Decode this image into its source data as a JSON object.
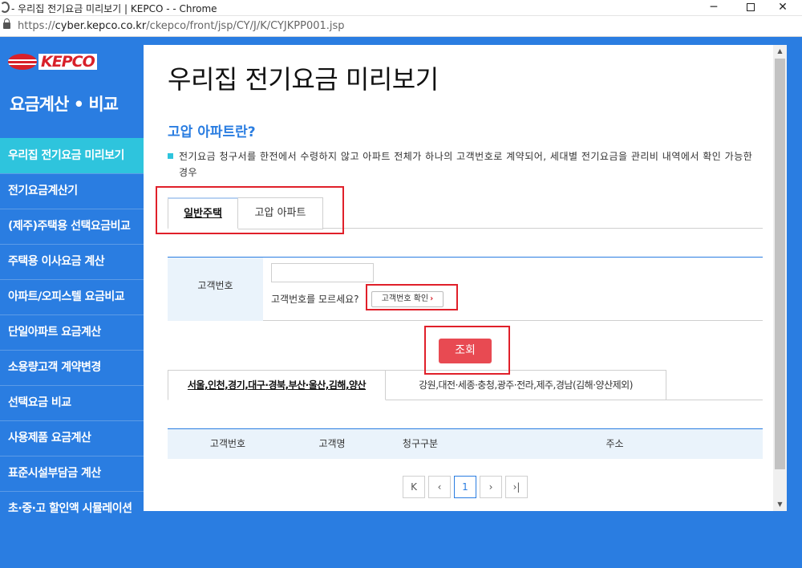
{
  "window": {
    "title": "- 우리집 전기요금 미리보기 | KEPCO - - Chrome",
    "minimize": "─",
    "close": "✕"
  },
  "address_bar": {
    "url_scheme": "https://",
    "url_host": "cyber.kepco.co.kr",
    "url_path": "/ckepco/front/jsp/CY/J/K/CYJKPP001.jsp"
  },
  "sidebar": {
    "logo": "KEPCO",
    "title": "요금계산 • 비교",
    "items": [
      {
        "label": "우리집 전기요금 미리보기",
        "active": true
      },
      {
        "label": "전기요금계산기"
      },
      {
        "label": "(제주)주택용 선택요금비교"
      },
      {
        "label": "주택용 이사요금 계산"
      },
      {
        "label": "아파트/오피스텔 요금비교"
      },
      {
        "label": "단일아파트 요금계산"
      },
      {
        "label": "소용량고객 계약변경"
      },
      {
        "label": "선택요금 비교"
      },
      {
        "label": "사용제품 요금계산"
      },
      {
        "label": "표준시설부담금 계산"
      },
      {
        "label": "초·중·고 할인액 시뮬레이션"
      }
    ]
  },
  "main": {
    "page_title": "우리집 전기요금 미리보기",
    "section_title": "고압 아파트란?",
    "description": "전기요금 청구서를 한전에서 수령하지 않고 아파트 전체가 하나의 고객번호로 계약되어, 세대별 전기요금을 관리비 내역에서 확인 가능한 경우",
    "tabs": [
      {
        "label": "일반주택",
        "active": true
      },
      {
        "label": "고압 아파트"
      }
    ],
    "form": {
      "customer_number_label": "고객번호",
      "customer_number_value": "",
      "hint": "고객번호를 모르세요?",
      "check_button": "고객번호 확인",
      "check_chevron": "›"
    },
    "search_button": "조회",
    "region_tabs": [
      {
        "label": "서울,인천,경기,대구·경북,부산·울산,김해,양산",
        "active": true
      },
      {
        "label": "강원,대전·세종·충청,광주·전라,제주,경남(김해·양산제외)"
      }
    ],
    "result_table": {
      "columns": [
        "고객번호",
        "고객명",
        "청구구분",
        "주소"
      ]
    },
    "pagination": {
      "first": "K",
      "prev": "‹",
      "current": "1",
      "next": "›",
      "last": "›|"
    }
  },
  "scrollbar": {
    "up": "▲",
    "down": "▼"
  },
  "colors": {
    "primary_blue": "#2a7de1",
    "active_cyan": "#2ec4dd",
    "search_red": "#e84a52",
    "highlight_red": "#e0202a"
  }
}
